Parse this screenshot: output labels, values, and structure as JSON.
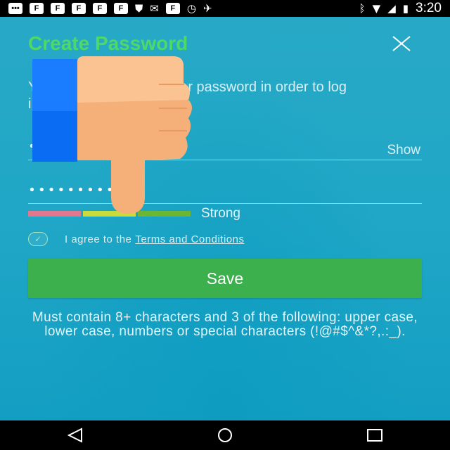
{
  "status_bar": {
    "notification_icons": [
      "message-icon",
      "flipboard-icon",
      "flipboard-icon",
      "flipboard-icon",
      "flipboard-icon",
      "flipboard-icon",
      "shield-icon",
      "email-icon",
      "flipboard-icon",
      "alarm-icon",
      "satellite-icon"
    ],
    "icon_letters": {
      "flipboard": "F",
      "message": "•••"
    },
    "time": "3:20"
  },
  "header": {
    "title": "Create Password",
    "close_icon": "close-icon"
  },
  "subtitle": "Y...r password in order to log i...",
  "subtitle_partial": {
    "line1_left": "Y",
    "line1_right": "r password in order to log",
    "line2": "i"
  },
  "password_field": {
    "value": "•••••••••",
    "toggle_label": "Show"
  },
  "confirm_field": {
    "value": "•••••••••"
  },
  "strength": {
    "label": "Strong",
    "segment_colors": [
      "#e2788e",
      "#c9dc3b",
      "#6cb535"
    ]
  },
  "agree": {
    "checked": true,
    "text": "I agree to the",
    "link": "Terms and Conditions"
  },
  "save_button": {
    "label": "Save"
  },
  "hint": "Must contain 8+ characters and 3 of the following: upper case, lower case, numbers or special characters (!@#$^&*?,.:_).",
  "overlay": {
    "icon": "thumbs-down-icon",
    "colors": {
      "blue": "#0a6cf2",
      "skin": "#f5b07a"
    }
  },
  "colors": {
    "background": "#1ba3c4",
    "title_green": "#4fd86a",
    "save_green": "#3cb04d"
  },
  "nav_bar": {
    "buttons": [
      "back-icon",
      "home-icon",
      "recents-icon"
    ]
  }
}
